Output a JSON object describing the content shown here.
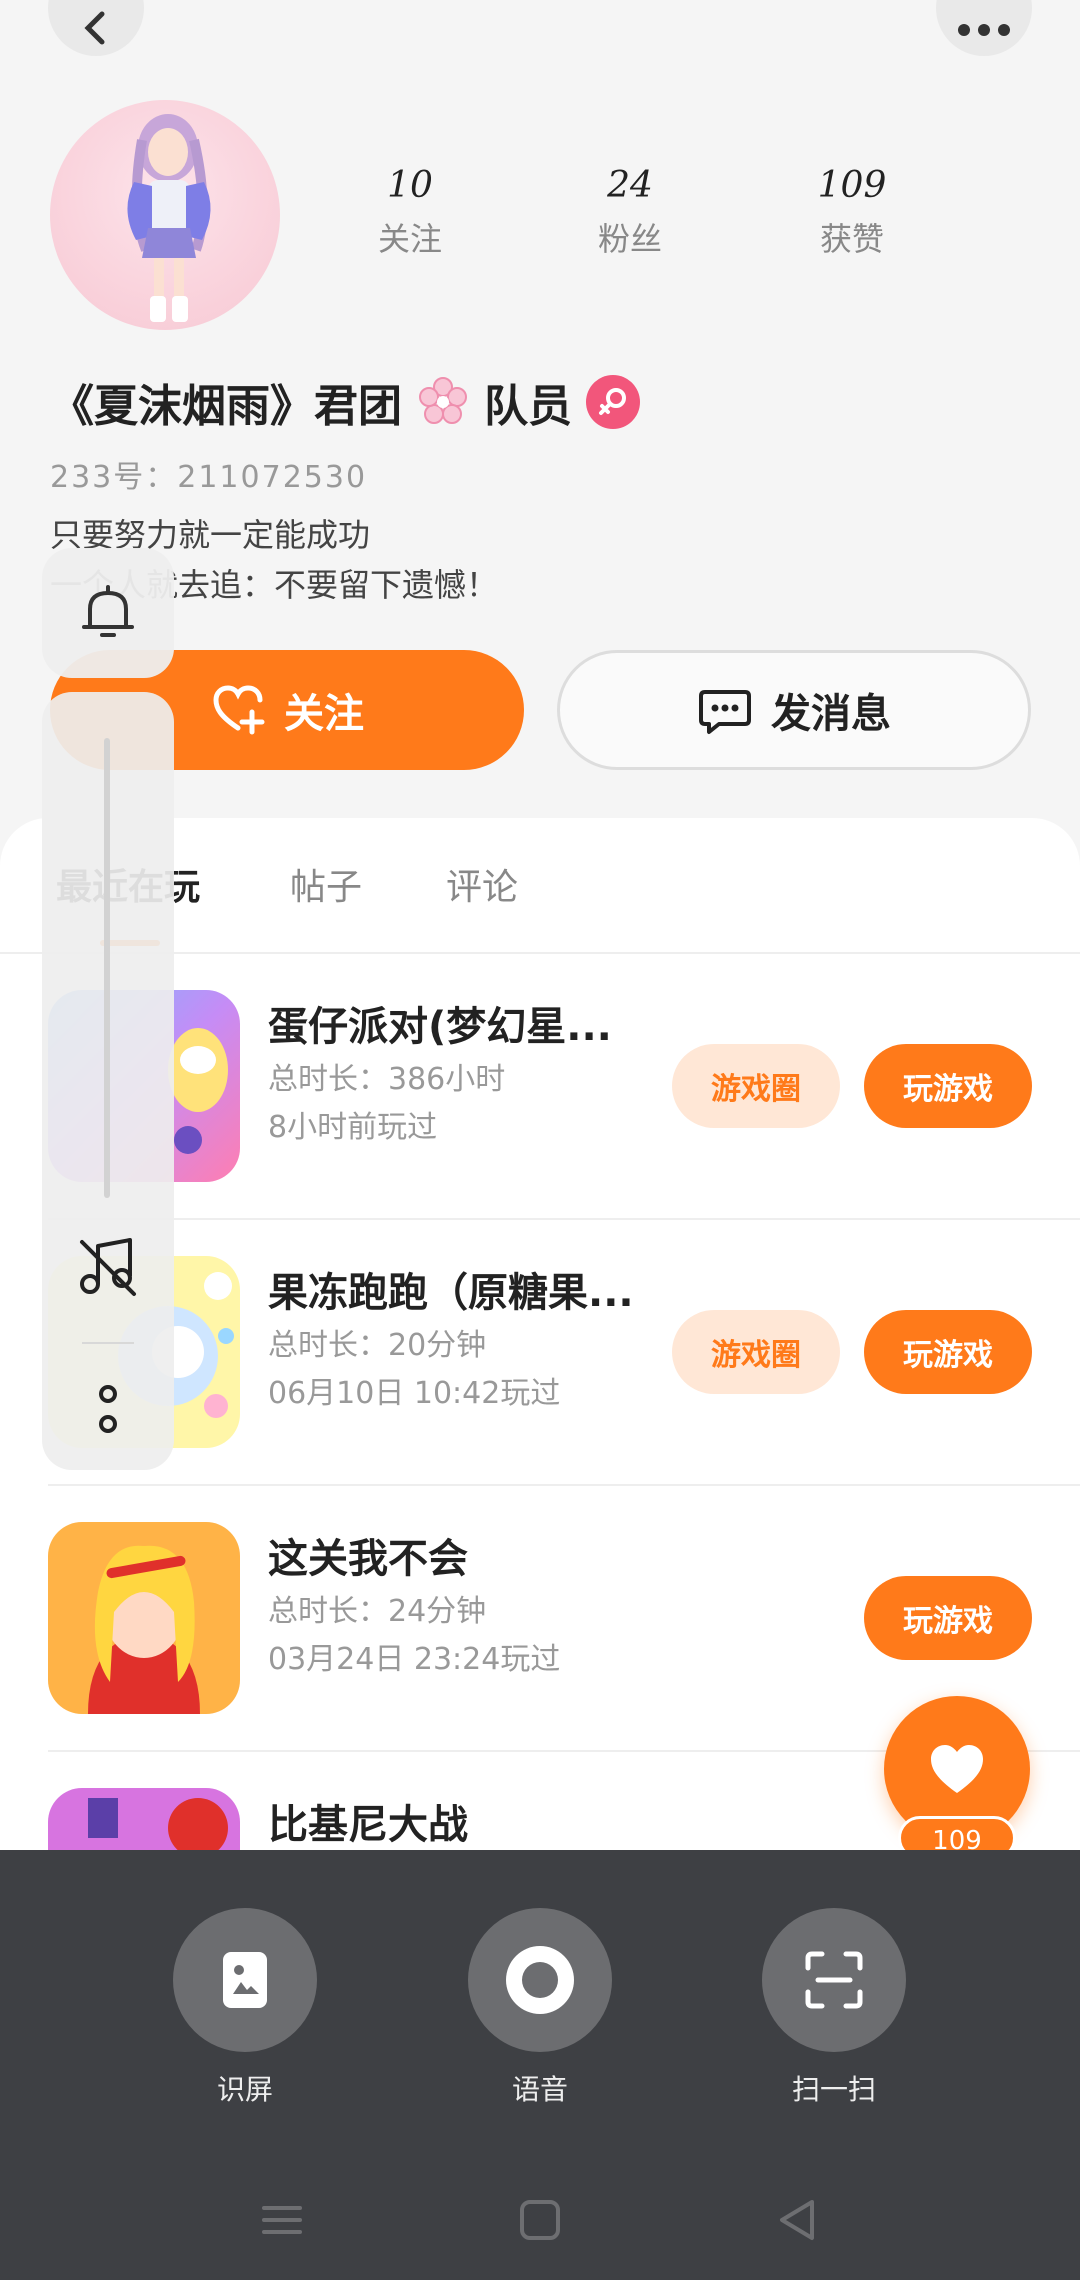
{
  "header": {
    "back_icon": "chevron-left-icon",
    "more_icon": "more-dots-icon"
  },
  "profile": {
    "stats": [
      {
        "value": "10",
        "label": "关注"
      },
      {
        "value": "24",
        "label": "粉丝"
      },
      {
        "value": "109",
        "label": "获赞"
      }
    ],
    "name_prefix": "《夏沫烟雨》君团",
    "name_suffix": "队员",
    "gender_icon": "female-icon",
    "uid": "233号：211072530",
    "bio_line1": "只要努力就一定能成功",
    "bio_line2": "一个人就去追：不要留下遗憾！",
    "follow_label": "关注",
    "message_label": "发消息"
  },
  "tabs": [
    "最近在玩",
    "帖子",
    "评论"
  ],
  "games": [
    {
      "name": "蛋仔派对(梦幻星...",
      "duration": "总时长：386小时",
      "last_played": "8小时前玩过",
      "circle_label": "游戏圈",
      "play_label": "玩游戏"
    },
    {
      "name": "果冻跑跑（原糖果...",
      "duration": "总时长：20分钟",
      "last_played": "06月10日 10:42玩过",
      "circle_label": "游戏圈",
      "play_label": "玩游戏"
    },
    {
      "name": "这关我不会",
      "duration": "总时长：24分钟",
      "last_played": "03月24日 23:24玩过",
      "play_label": "玩游戏"
    },
    {
      "name": "比基尼大战"
    }
  ],
  "like_fab": {
    "count": "109"
  },
  "assistant": {
    "actions": [
      {
        "label": "识屏",
        "icon": "screen-recognize-icon"
      },
      {
        "label": "语音",
        "icon": "voice-icon"
      },
      {
        "label": "扫一扫",
        "icon": "scan-icon"
      }
    ]
  },
  "colors": {
    "accent": "#ff7a1a",
    "accent_light": "#ffe7d6",
    "female": "#f2567b",
    "sheet": "#3e4044"
  }
}
